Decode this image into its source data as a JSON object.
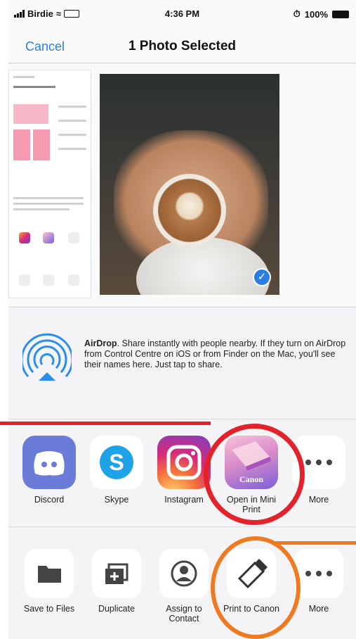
{
  "status_bar": {
    "carrier": "Birdie",
    "time": "4:36 PM",
    "battery": "100%"
  },
  "nav": {
    "cancel_label": "Cancel",
    "title": "1 Photo Selected"
  },
  "airdrop": {
    "heading": "AirDrop",
    "text": ". Share instantly with people nearby. If they turn on AirDrop from Control Centre on iOS or from Finder on the Mac, you'll see their names here. Just tap to share."
  },
  "apps_row": [
    {
      "label": "Discord",
      "icon": "discord-icon"
    },
    {
      "label": "Skype",
      "icon": "skype-icon"
    },
    {
      "label": "Instagram",
      "icon": "instagram-icon"
    },
    {
      "label": "Open in Mini Print",
      "icon": "canon-mini-print-icon",
      "badge": "Canon"
    },
    {
      "label": "More",
      "icon": "more-icon"
    }
  ],
  "actions_row": [
    {
      "label": "Save to Files",
      "icon": "folder-icon"
    },
    {
      "label": "Duplicate",
      "icon": "duplicate-icon"
    },
    {
      "label": "Assign to Contact",
      "icon": "contact-icon"
    },
    {
      "label": "Print to Canon",
      "icon": "print-icon"
    },
    {
      "label": "More",
      "icon": "more-icon"
    }
  ],
  "colors": {
    "accent": "#2a7de1",
    "highlight_red": "#e3232c",
    "highlight_orange": "#f07a20"
  }
}
